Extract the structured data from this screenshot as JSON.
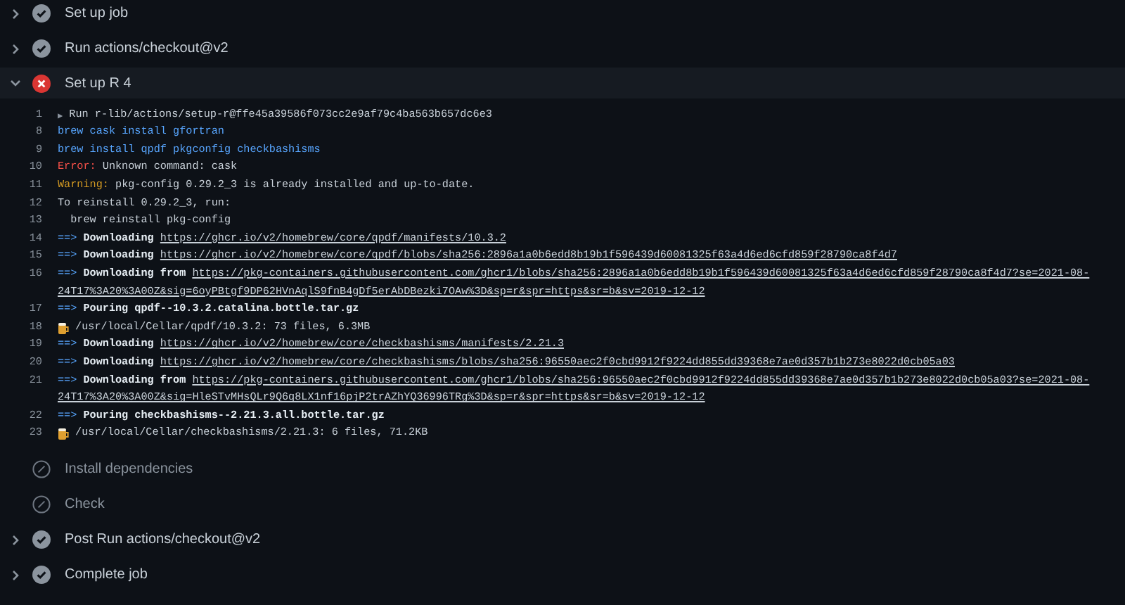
{
  "steps": [
    {
      "label": "Set up job",
      "kind": "success",
      "expanded": false
    },
    {
      "label": "Run actions/checkout@v2",
      "kind": "success",
      "expanded": false
    },
    {
      "label": "Set up R 4",
      "kind": "failure",
      "expanded": true,
      "log": [
        {
          "number": "1",
          "parts": [
            {
              "kind": "toggle",
              "text": "▶"
            },
            {
              "kind": "plain",
              "text": "Run r-lib/actions/setup-r@ffe45a39586f073cc2e9af79c4ba563b657dc6e3"
            }
          ]
        },
        {
          "number": "8",
          "parts": [
            {
              "kind": "command",
              "text": "brew cask install gfortran"
            }
          ]
        },
        {
          "number": "9",
          "parts": [
            {
              "kind": "command",
              "text": "brew install qpdf pkgconfig checkbashisms"
            }
          ]
        },
        {
          "number": "10",
          "parts": [
            {
              "kind": "error",
              "text": "Error:"
            },
            {
              "kind": "plain",
              "text": "Unknown command: cask"
            }
          ]
        },
        {
          "number": "11",
          "parts": [
            {
              "kind": "warning",
              "text": "Warning:"
            },
            {
              "kind": "plain",
              "text": "pkg-config 0.29.2_3 is already installed and up-to-date."
            }
          ]
        },
        {
          "number": "12",
          "parts": [
            {
              "kind": "plain",
              "text": "To reinstall 0.29.2_3, run:"
            }
          ]
        },
        {
          "number": "13",
          "parts": [
            {
              "kind": "plain",
              "text": "  brew reinstall pkg-config"
            }
          ]
        },
        {
          "number": "14",
          "parts": [
            {
              "kind": "arrow",
              "text": "==>"
            },
            {
              "kind": "bold",
              "text": "Downloading"
            },
            {
              "kind": "link",
              "text": "https://ghcr.io/v2/homebrew/core/qpdf/manifests/10.3.2"
            }
          ]
        },
        {
          "number": "15",
          "parts": [
            {
              "kind": "arrow",
              "text": "==>"
            },
            {
              "kind": "bold",
              "text": "Downloading"
            },
            {
              "kind": "link",
              "text": "https://ghcr.io/v2/homebrew/core/qpdf/blobs/sha256:2896a1a0b6edd8b19b1f596439d60081325f63a4d6ed6cfd859f28790ca8f4d7"
            }
          ]
        },
        {
          "number": "16",
          "parts": [
            {
              "kind": "arrow",
              "text": "==>"
            },
            {
              "kind": "bold",
              "text": "Downloading from"
            },
            {
              "kind": "link",
              "text": "https://pkg-containers.githubusercontent.com/ghcr1/blobs/sha256:2896a1a0b6edd8b19b1f596439d60081325f63a4d6ed6cfd859f28790ca8f4d7?se=2021-08-"
            }
          ]
        },
        {
          "parts": [
            {
              "kind": "link",
              "text": "24T17%3A20%3A00Z&sig=6oyPBtgf9DP62HVnAqlS9fnB4gDf5erAbDBezki7OAw%3D&sp=r&spr=https&sr=b&sv=2019-12-12"
            }
          ]
        },
        {
          "number": "17",
          "parts": [
            {
              "kind": "arrow",
              "text": "==>"
            },
            {
              "kind": "bold",
              "text": "Pouring qpdf--10.3.2.catalina.bottle.tar.gz"
            }
          ]
        },
        {
          "number": "18",
          "parts": [
            {
              "kind": "beer"
            },
            {
              "kind": "plain",
              "text": "/usr/local/Cellar/qpdf/10.3.2: 73 files, 6.3MB"
            }
          ]
        },
        {
          "number": "19",
          "parts": [
            {
              "kind": "arrow",
              "text": "==>"
            },
            {
              "kind": "bold",
              "text": "Downloading"
            },
            {
              "kind": "link",
              "text": "https://ghcr.io/v2/homebrew/core/checkbashisms/manifests/2.21.3"
            }
          ]
        },
        {
          "number": "20",
          "parts": [
            {
              "kind": "arrow",
              "text": "==>"
            },
            {
              "kind": "bold",
              "text": "Downloading"
            },
            {
              "kind": "link",
              "text": "https://ghcr.io/v2/homebrew/core/checkbashisms/blobs/sha256:96550aec2f0cbd9912f9224dd855dd39368e7ae0d357b1b273e8022d0cb05a03"
            }
          ]
        },
        {
          "number": "21",
          "parts": [
            {
              "kind": "arrow",
              "text": "==>"
            },
            {
              "kind": "bold",
              "text": "Downloading from"
            },
            {
              "kind": "link",
              "text": "https://pkg-containers.githubusercontent.com/ghcr1/blobs/sha256:96550aec2f0cbd9912f9224dd855dd39368e7ae0d357b1b273e8022d0cb05a03?se=2021-08-"
            }
          ]
        },
        {
          "parts": [
            {
              "kind": "link",
              "text": "24T17%3A20%3A00Z&sig=HleSTvMHsQLr9Q6q8LX1nf16pjP2trAZhYQ36996TRg%3D&sp=r&spr=https&sr=b&sv=2019-12-12"
            }
          ]
        },
        {
          "number": "22",
          "parts": [
            {
              "kind": "arrow",
              "text": "==>"
            },
            {
              "kind": "bold",
              "text": "Pouring checkbashisms--2.21.3.all.bottle.tar.gz"
            }
          ]
        },
        {
          "number": "23",
          "parts": [
            {
              "kind": "beer"
            },
            {
              "kind": "plain",
              "text": "/usr/local/Cellar/checkbashisms/2.21.3: 6 files, 71.2KB"
            }
          ]
        }
      ]
    },
    {
      "label": "Install dependencies",
      "kind": "skipped"
    },
    {
      "label": "Check",
      "kind": "skipped"
    },
    {
      "label": "Post Run actions/checkout@v2",
      "kind": "success",
      "expanded": false
    },
    {
      "label": "Complete job",
      "kind": "success",
      "expanded": false
    }
  ]
}
